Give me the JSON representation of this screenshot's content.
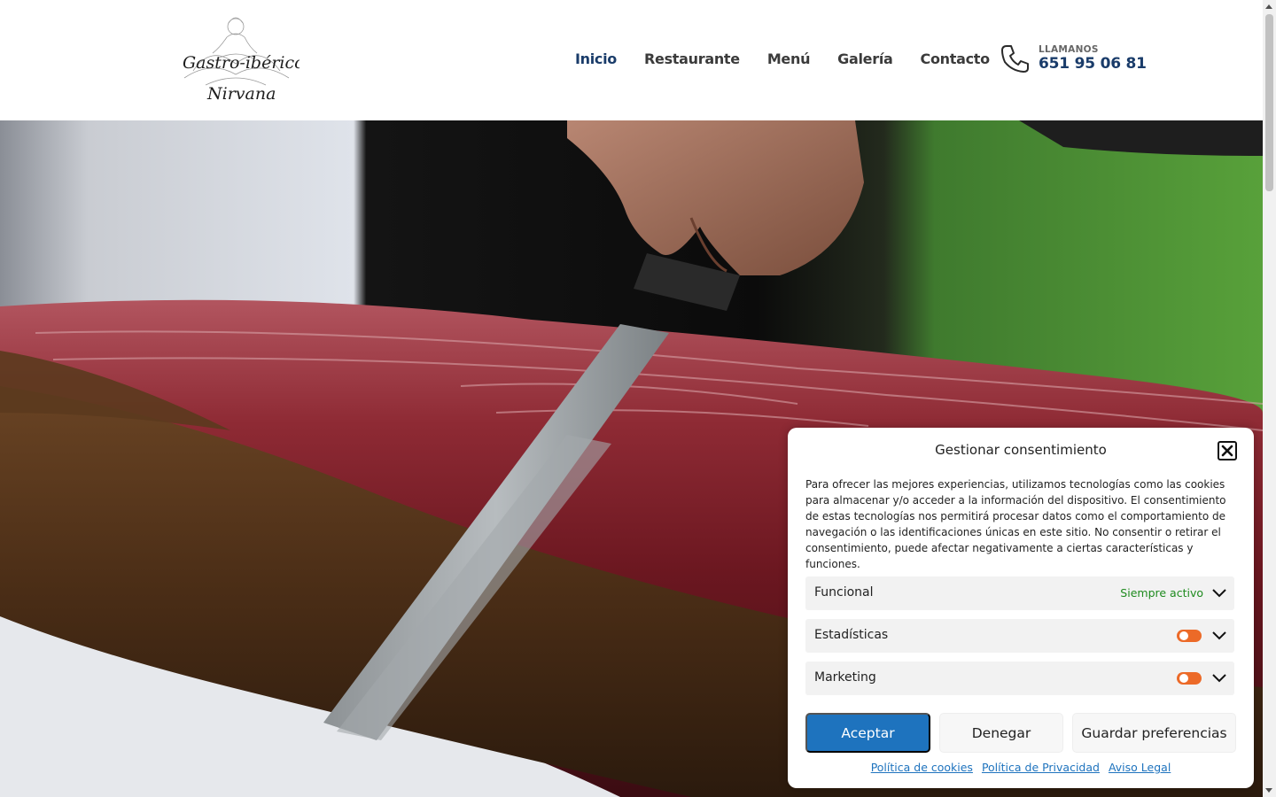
{
  "header": {
    "logo": {
      "line1": "Gastro-ibérico",
      "line2": "Nirvana"
    },
    "nav": [
      {
        "label": "Inicio"
      },
      {
        "label": "Restaurante"
      },
      {
        "label": "Menú"
      },
      {
        "label": "Galería"
      },
      {
        "label": "Contacto"
      }
    ],
    "phone": {
      "kicker": "LLAMANOS",
      "number": "651 95 06 81",
      "icon": "phone-icon"
    }
  },
  "consent": {
    "title": "Gestionar consentimiento",
    "close_icon": "close-icon",
    "text": "Para ofrecer las mejores experiencias, utilizamos tecnologías como las cookies para almacenar y/o acceder a la información del dispositivo. El consentimiento de estas tecnologías nos permitirá procesar datos como el comportamiento de navegación o las identificaciones únicas en este sitio. No consentir o retirar el consentimiento, puede afectar negativamente a ciertas características y funciones.",
    "categories": [
      {
        "label": "Funcional",
        "status": "Siempre activo"
      },
      {
        "label": "Estadísticas"
      },
      {
        "label": "Marketing"
      }
    ],
    "buttons": {
      "accept": "Aceptar",
      "deny": "Denegar",
      "preferences": "Guardar preferencias"
    },
    "links": [
      "Política de cookies",
      "Política de Privacidad",
      "Aviso Legal"
    ],
    "colors": {
      "accent": "#1e73be",
      "toggle": "#ec6a28",
      "always_active": "#1e8a1e"
    }
  },
  "colors": {
    "nav_active": "#1a3c6a",
    "nav_text": "#3b3b3b"
  }
}
